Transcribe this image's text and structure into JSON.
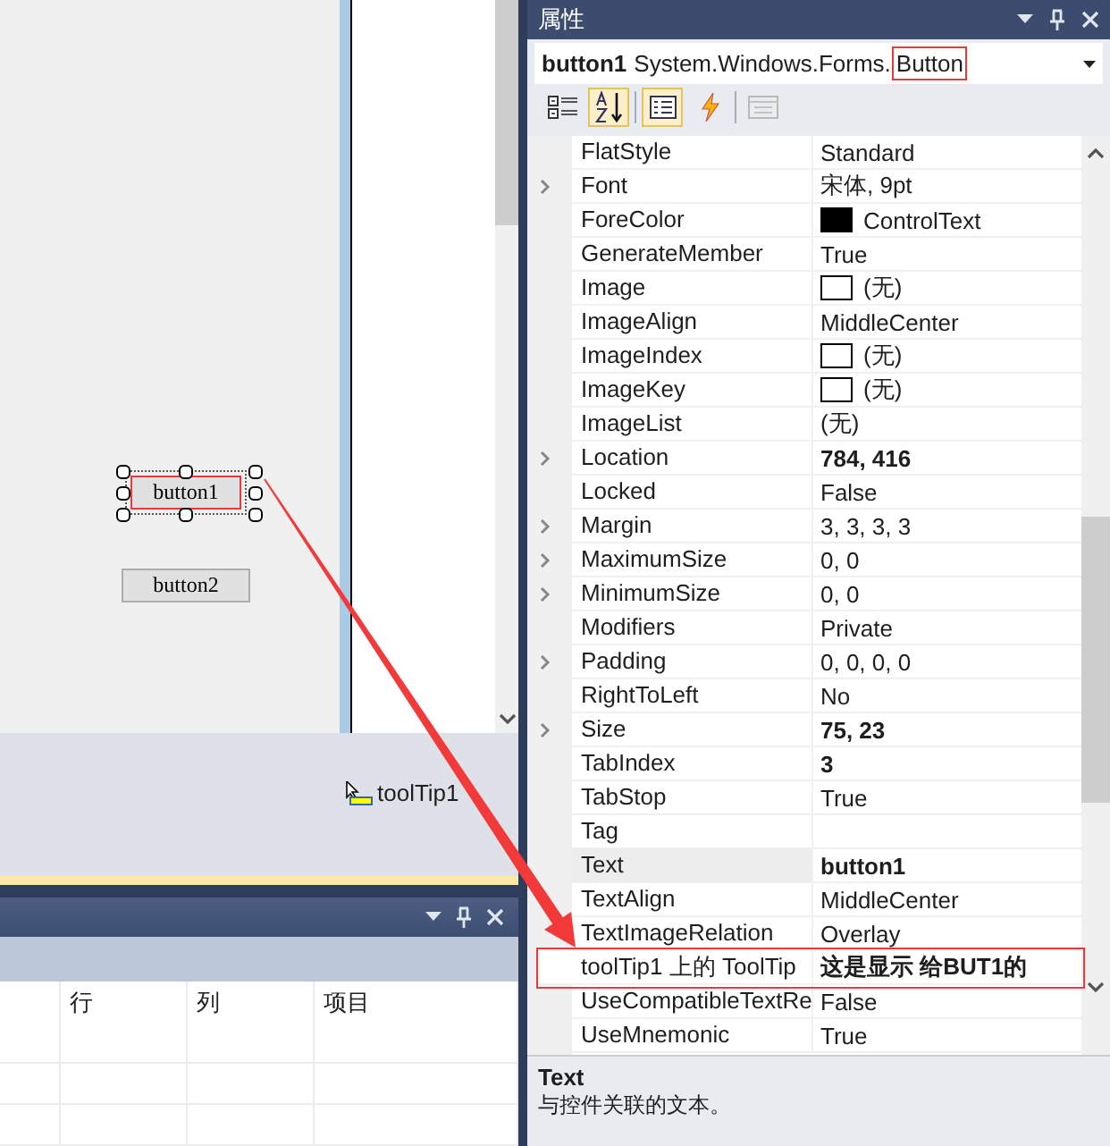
{
  "designer": {
    "buttons": [
      {
        "label": "button1",
        "selected": true
      },
      {
        "label": "button2",
        "selected": false
      }
    ],
    "tray": [
      {
        "label": "toolTip1"
      }
    ]
  },
  "error_list": {
    "columns": [
      {
        "label": "行"
      },
      {
        "label": "列"
      },
      {
        "label": "项目"
      }
    ]
  },
  "properties": {
    "title": "属性",
    "object_name": "button1",
    "object_namespace": "System.Windows.Forms.",
    "object_class": "Button",
    "toolbar": [
      {
        "kind": "categorized",
        "selected": false,
        "disabled": false
      },
      {
        "kind": "alphabetical",
        "selected": true,
        "disabled": false
      },
      {
        "kind": "properties",
        "selected": true,
        "disabled": false
      },
      {
        "kind": "events",
        "selected": false,
        "disabled": false
      },
      {
        "kind": "pages",
        "selected": false,
        "disabled": true
      }
    ],
    "rows": [
      {
        "name": "FlatStyle",
        "value": "Standard",
        "expandable": false,
        "bold": false,
        "selected": false,
        "highlighted": false
      },
      {
        "name": "Font",
        "value": "宋体, 9pt",
        "expandable": true,
        "bold": false,
        "selected": false,
        "highlighted": false
      },
      {
        "name": "ForeColor",
        "value": "ControlText",
        "color": "#000000",
        "expandable": false,
        "bold": false,
        "selected": false,
        "highlighted": false
      },
      {
        "name": "GenerateMember",
        "value": "True",
        "expandable": false,
        "bold": false,
        "selected": false,
        "highlighted": false
      },
      {
        "name": "Image",
        "value": "(无)",
        "color": "#ffffff",
        "expandable": false,
        "bold": false,
        "selected": false,
        "highlighted": false
      },
      {
        "name": "ImageAlign",
        "value": "MiddleCenter",
        "expandable": false,
        "bold": false,
        "selected": false,
        "highlighted": false
      },
      {
        "name": "ImageIndex",
        "value": "(无)",
        "color": "#ffffff",
        "expandable": false,
        "bold": false,
        "selected": false,
        "highlighted": false
      },
      {
        "name": "ImageKey",
        "value": "(无)",
        "color": "#ffffff",
        "expandable": false,
        "bold": false,
        "selected": false,
        "highlighted": false
      },
      {
        "name": "ImageList",
        "value": "(无)",
        "expandable": false,
        "bold": false,
        "selected": false,
        "highlighted": false
      },
      {
        "name": "Location",
        "value": "784, 416",
        "expandable": true,
        "bold": true,
        "selected": false,
        "highlighted": false
      },
      {
        "name": "Locked",
        "value": "False",
        "expandable": false,
        "bold": false,
        "selected": false,
        "highlighted": false
      },
      {
        "name": "Margin",
        "value": "3, 3, 3, 3",
        "expandable": true,
        "bold": false,
        "selected": false,
        "highlighted": false
      },
      {
        "name": "MaximumSize",
        "value": "0, 0",
        "expandable": true,
        "bold": false,
        "selected": false,
        "highlighted": false
      },
      {
        "name": "MinimumSize",
        "value": "0, 0",
        "expandable": true,
        "bold": false,
        "selected": false,
        "highlighted": false
      },
      {
        "name": "Modifiers",
        "value": "Private",
        "expandable": false,
        "bold": false,
        "selected": false,
        "highlighted": false
      },
      {
        "name": "Padding",
        "value": "0, 0, 0, 0",
        "expandable": true,
        "bold": false,
        "selected": false,
        "highlighted": false
      },
      {
        "name": "RightToLeft",
        "value": "No",
        "expandable": false,
        "bold": false,
        "selected": false,
        "highlighted": false
      },
      {
        "name": "Size",
        "value": "75, 23",
        "expandable": true,
        "bold": true,
        "selected": false,
        "highlighted": false
      },
      {
        "name": "TabIndex",
        "value": "3",
        "expandable": false,
        "bold": true,
        "selected": false,
        "highlighted": false
      },
      {
        "name": "TabStop",
        "value": "True",
        "expandable": false,
        "bold": false,
        "selected": false,
        "highlighted": false
      },
      {
        "name": "Tag",
        "expandable": false,
        "selected": false,
        "highlighted": false
      },
      {
        "name": "Text",
        "value": "button1",
        "expandable": false,
        "bold": true,
        "selected": true,
        "highlighted": false
      },
      {
        "name": "TextAlign",
        "value": "MiddleCenter",
        "expandable": false,
        "bold": false,
        "selected": false,
        "highlighted": false
      },
      {
        "name": "TextImageRelation",
        "value": "Overlay",
        "expandable": false,
        "bold": false,
        "selected": false,
        "highlighted": false
      },
      {
        "name": "toolTip1 上的 ToolTip",
        "value": "这是显示 给BUT1的",
        "expandable": false,
        "bold": true,
        "selected": false,
        "highlighted": true
      },
      {
        "name": "UseCompatibleTextRe",
        "value": "False",
        "expandable": false,
        "bold": false,
        "selected": false,
        "highlighted": false
      },
      {
        "name": "UseMnemonic",
        "value": "True",
        "expandable": false,
        "bold": false,
        "selected": false,
        "highlighted": false
      }
    ],
    "description": {
      "title": "Text",
      "text": "与控件关联的文本。"
    }
  }
}
